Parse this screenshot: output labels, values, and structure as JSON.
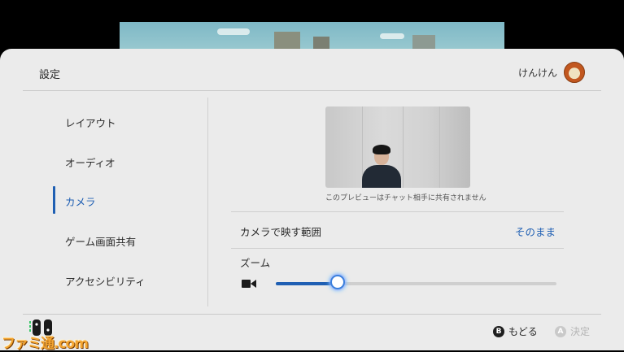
{
  "window": {
    "title": "設定"
  },
  "user": {
    "name": "けんけん"
  },
  "nav": {
    "items": [
      {
        "label": "レイアウト",
        "active": false
      },
      {
        "label": "オーディオ",
        "active": false
      },
      {
        "label": "カメラ",
        "active": true
      },
      {
        "label": "ゲーム画面共有",
        "active": false
      },
      {
        "label": "アクセシビリティ",
        "active": false
      }
    ]
  },
  "camera": {
    "preview_caption": "このプレビューはチャット相手に共有されません",
    "range_label": "カメラで映す範囲",
    "range_value": "そのまま",
    "zoom_label": "ズーム",
    "zoom_level": 0.22
  },
  "footer": {
    "back_glyph": "B",
    "back_label": "もどる",
    "confirm_glyph": "A",
    "confirm_label": "決定"
  },
  "watermark": {
    "text": "ファミ通.com"
  },
  "colors": {
    "accent": "#1f5fb3",
    "panel": "#ebebeb"
  }
}
